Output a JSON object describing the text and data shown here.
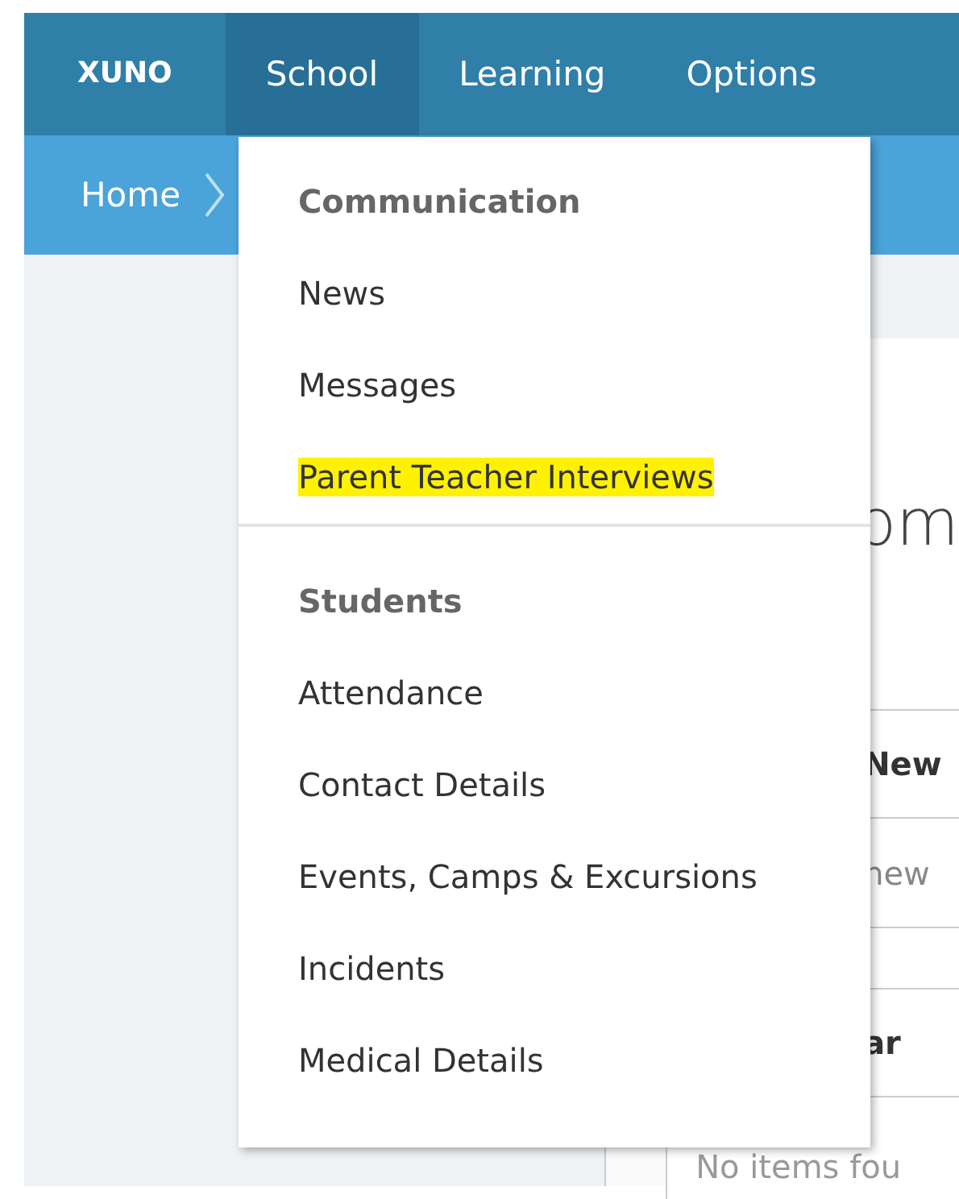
{
  "nav": {
    "logo": "XUNO",
    "items": [
      {
        "label": "School",
        "selected": true
      },
      {
        "label": "Learning",
        "selected": false
      },
      {
        "label": "Options",
        "selected": false
      }
    ]
  },
  "breadcrumb": {
    "items": [
      "Home"
    ]
  },
  "dropdown": {
    "sections": [
      {
        "heading": "Communication",
        "items": [
          {
            "label": "News",
            "highlighted": false
          },
          {
            "label": "Messages",
            "highlighted": false
          },
          {
            "label": "Parent Teacher Interviews",
            "highlighted": true
          }
        ]
      },
      {
        "heading": "Students",
        "items": [
          {
            "label": "Attendance",
            "highlighted": false
          },
          {
            "label": "Contact Details",
            "highlighted": false
          },
          {
            "label": "Events, Camps & Excursions",
            "highlighted": false
          },
          {
            "label": "Incidents",
            "highlighted": false
          },
          {
            "label": "Medical Details",
            "highlighted": false
          }
        ]
      }
    ]
  },
  "content": {
    "heading": "om",
    "rows": [
      {
        "kind": "header",
        "text": "New"
      },
      {
        "kind": "cell",
        "text": "new"
      },
      {
        "kind": "blank"
      },
      {
        "kind": "header",
        "text": "ar"
      },
      {
        "kind": "empty",
        "text": "No items fou"
      }
    ]
  }
}
